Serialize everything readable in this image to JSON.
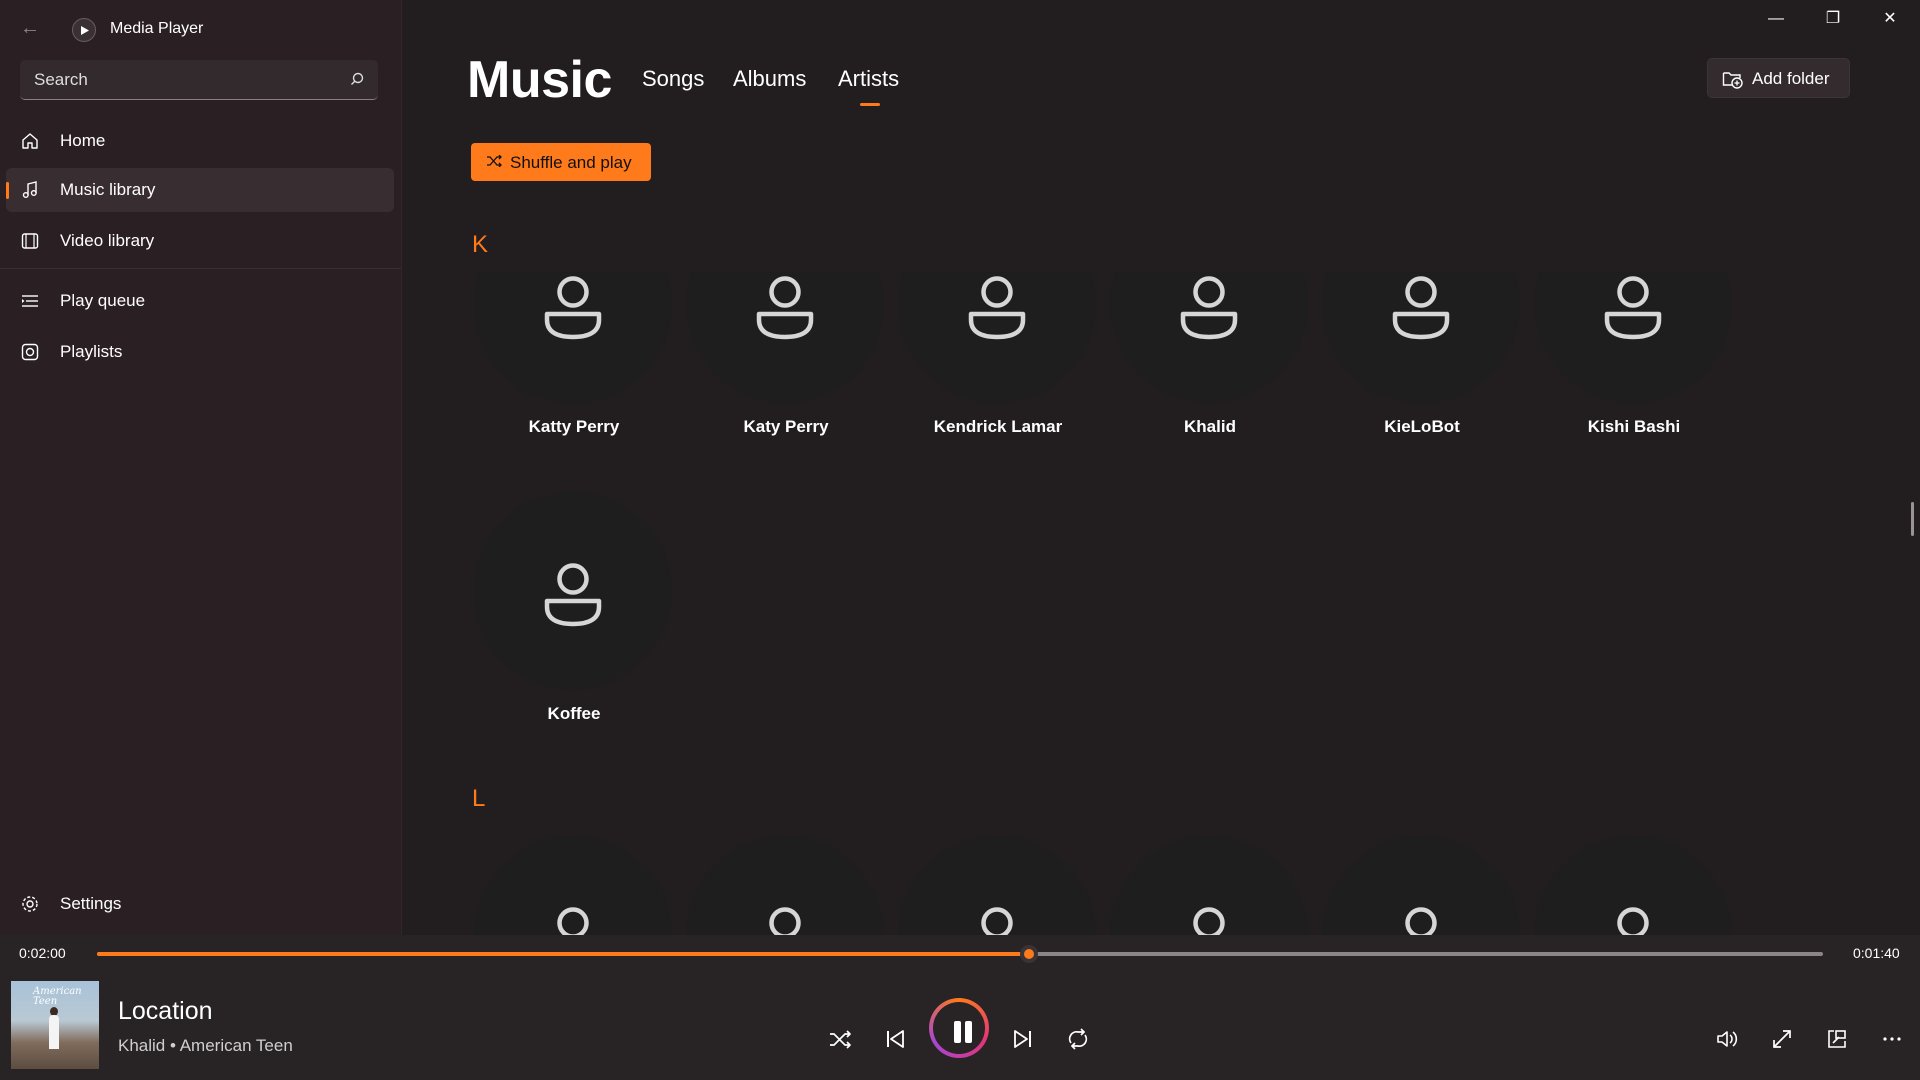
{
  "app": {
    "title": "Media Player"
  },
  "search": {
    "placeholder": "Search"
  },
  "nav": [
    {
      "label": "Home",
      "icon": "home-icon",
      "active": false
    },
    {
      "label": "Music library",
      "icon": "music-note-icon",
      "active": true
    },
    {
      "label": "Video library",
      "icon": "film-icon",
      "active": false
    },
    {
      "label": "Play queue",
      "icon": "queue-icon",
      "active": false
    },
    {
      "label": "Playlists",
      "icon": "playlist-icon",
      "active": false
    }
  ],
  "settings": {
    "label": "Settings"
  },
  "main": {
    "title": "Music",
    "tabs": [
      {
        "label": "Songs",
        "active": false
      },
      {
        "label": "Albums",
        "active": false
      },
      {
        "label": "Artists",
        "active": true
      }
    ],
    "add_folder_label": "Add folder",
    "shuffle_label": "Shuffle and play"
  },
  "sections": [
    {
      "letter": "K",
      "artists": [
        "Katty Perry",
        "Katy Perry",
        "Kendrick Lamar",
        "Khalid",
        "KieLoBot",
        "Kishi Bashi",
        "Koffee"
      ]
    },
    {
      "letter": "L",
      "artists": [
        "",
        "",
        "",
        "",
        "",
        ""
      ]
    }
  ],
  "player": {
    "elapsed": "0:02:00",
    "remaining": "0:01:40",
    "progress": 0.54,
    "song_title": "Location",
    "song_subtitle": "Khalid • American Teen",
    "album_art_text": "American Teen"
  },
  "colors": {
    "accent": "#ff7a1a",
    "sidebar": "#2a1f23",
    "background": "#221d1f",
    "player": "#282325"
  }
}
